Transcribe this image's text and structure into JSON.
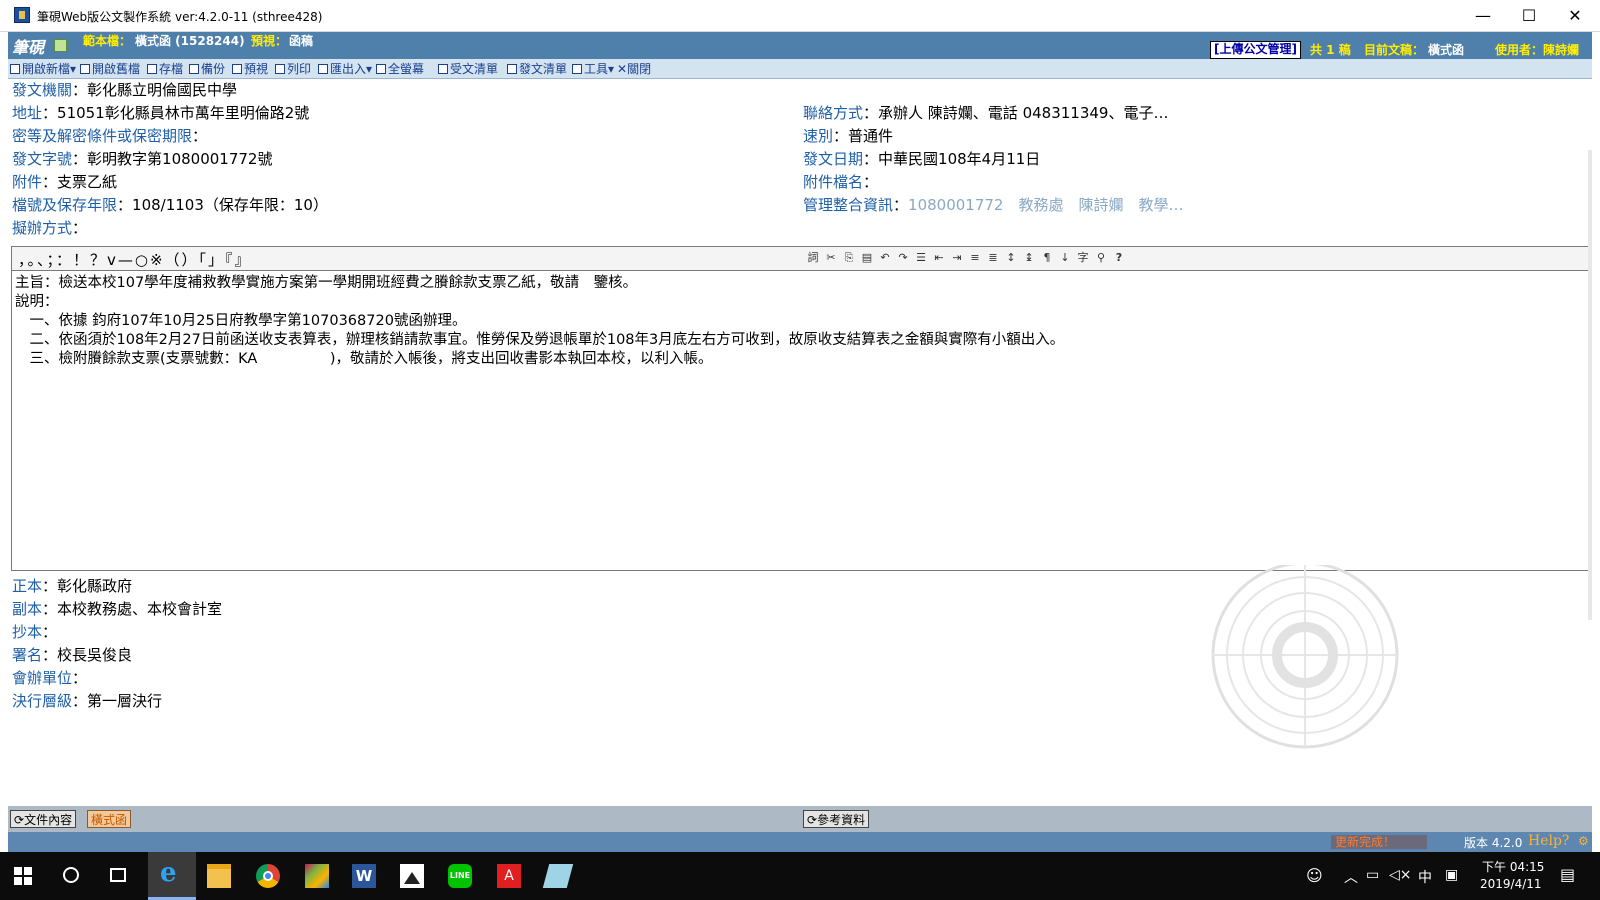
{
  "window": {
    "title": "筆硯Web版公文製作系統 ver:4.2.0-11 (sthree428)",
    "min_label": "—",
    "max_label": "☐",
    "close_label": "✕"
  },
  "header": {
    "logo_text": "筆硯",
    "template_label": "範本檔：",
    "template_value": "橫式函 (1528244)",
    "preview_label": "預視：",
    "preview_value": "函稿",
    "upload_button": "[上傳公文管理]",
    "total_label": "共 1 稿",
    "current_label": "目前文稿：",
    "current_value": "橫式函",
    "user_label": "使用者：",
    "user_value": "陳詩孄"
  },
  "toolbar": {
    "items": [
      "開啟新檔▾",
      "開啟舊檔",
      "存檔",
      "備份",
      "預視",
      "列印",
      "匯出入▾",
      "全螢幕",
      "受文清單",
      "發文清單",
      "工具▾",
      "關閉"
    ]
  },
  "form": {
    "issuer_label": "發文機關",
    "issuer_value": "彰化縣立明倫國民中學",
    "address_label": "地址",
    "address_value": "51051彰化縣員林市萬年里明倫路2號",
    "contact_label": "聯絡方式",
    "contact_value": "承辦人 陳詩孄、電話 048311349、電子…",
    "secret_label": "密等及解密條件或保密期限",
    "speed_label": "速別",
    "speed_value": "普通件",
    "docno_label": "發文字號",
    "docno_value": "彰明教字第1080001772號",
    "date_label": "發文日期",
    "date_value": "中華民國108年4月11日",
    "attach_label": "附件",
    "attach_value": "支票乙紙",
    "attachfile_label": "附件檔名",
    "archive_label": "檔號及保存年限",
    "archive_value": "108/1103（保存年限：10）",
    "mgmt_label": "管理整合資訊",
    "mgmt_values": [
      "1080001772",
      "教務處",
      "陳詩孄",
      "教學…"
    ],
    "method_label": "擬辦方式"
  },
  "editor": {
    "punctuation": "，。、；：！？ⅴ—○※（）「」『』",
    "lines": [
      "主旨：檢送本校107學年度補救教學實施方案第一學期開班經費之賸餘款支票乙紙，敬請　鑒核。",
      "說明：",
      "　一、依據 鈞府107年10月25日府教學字第1070368720號函辦理。",
      "　二、依函須於108年2月27日前函送收支表算表，辦理核銷請款事宜。惟勞保及勞退帳單於108年3月底左右方可收到，故原收支結算表之金額與實際有小額出入。",
      "　三、檢附賸餘款支票(支票號數：KA　　　　　)，敬請於入帳後，將支出回收書影本執回本校，以利入帳。"
    ]
  },
  "lower": {
    "main_label": "正本",
    "main_value": "彰化縣政府",
    "cc_label": "副本",
    "cc_value": "本校教務處、本校會計室",
    "copy_label": "抄本",
    "sign_label": "署名",
    "sign_value": "校長吳俊良",
    "co_label": "會辦單位",
    "level_label": "決行層級",
    "level_value": "第一層決行"
  },
  "bottom": {
    "doc_content": "文件內容",
    "format_tab": "橫式函",
    "reference": "參考資料",
    "status_text": "更新完成！",
    "version": "版本 4.2.0",
    "help": "Help?"
  },
  "taskbar": {
    "time": "下午 04:15",
    "date": "2019/4/11",
    "ime": "中"
  }
}
